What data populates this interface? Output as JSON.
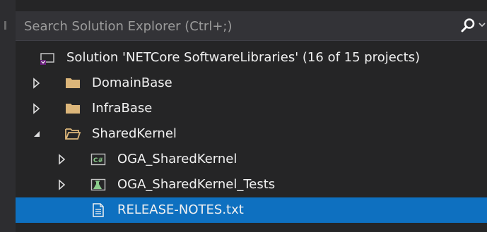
{
  "search": {
    "placeholder": "Search Solution Explorer (Ctrl+;)"
  },
  "colors": {
    "background": "#252526",
    "selection": "#0e70c0",
    "folder": "#dcb67a",
    "text": "#f1f1f1"
  },
  "tree": {
    "solution": {
      "label": "Solution 'NETCore SoftwareLibraries' (16 of 15 projects)",
      "icon": "solution-icon"
    },
    "items": [
      {
        "label": "DomainBase",
        "icon": "folder-icon",
        "expanded": false
      },
      {
        "label": "InfraBase",
        "icon": "folder-icon",
        "expanded": false
      },
      {
        "label": "SharedKernel",
        "icon": "folder-open-icon",
        "expanded": true
      },
      {
        "label": "OGA_SharedKernel",
        "icon": "csharp-project-icon",
        "expanded": false
      },
      {
        "label": "OGA_SharedKernel_Tests",
        "icon": "test-project-icon",
        "expanded": false
      },
      {
        "label": "RELEASE-NOTES.txt",
        "icon": "text-file-icon",
        "selected": true
      }
    ]
  }
}
